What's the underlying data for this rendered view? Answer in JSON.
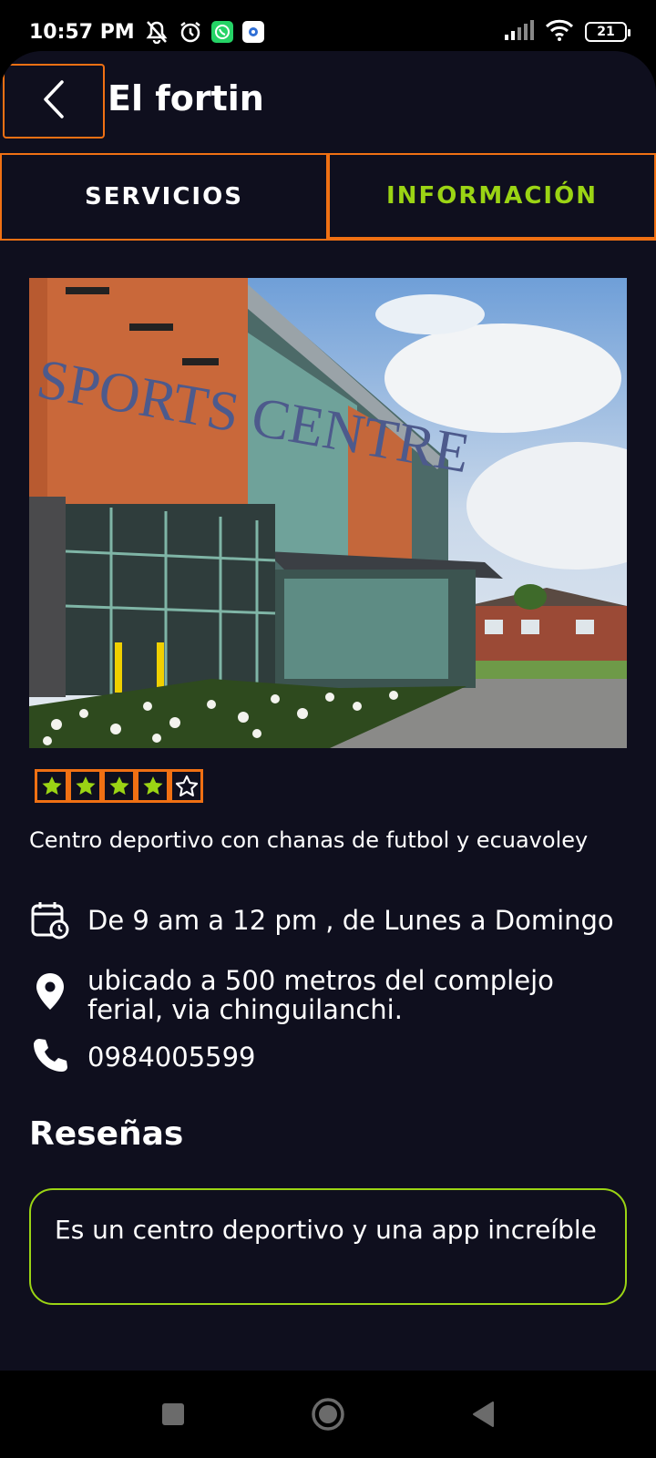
{
  "status_bar": {
    "time": "10:57 PM",
    "battery": "21",
    "icons": [
      "mute-icon",
      "alarm-icon",
      "whatsapp-icon",
      "app-icon",
      "signal-icon",
      "wifi-icon",
      "battery-icon"
    ]
  },
  "header": {
    "title": "El fortin",
    "back_icon": "chevron-left-icon"
  },
  "tabs": [
    {
      "label": "SERVICIOS",
      "active": false
    },
    {
      "label": "INFORMACIÓN",
      "active": true
    }
  ],
  "venue": {
    "image_alt": "sports-centre-photo",
    "sign_text": "SPORTS CENTRE",
    "rating": 4,
    "rating_max": 5,
    "description": "Centro deportivo con chanas de futbol y ecuavoley",
    "schedule": "De 9 am a 12 pm , de Lunes a Domingo",
    "location": "ubicado a 500 metros del complejo ferial, via chinguilanchi.",
    "phone": "0984005599"
  },
  "reviews": {
    "title": "Reseñas",
    "items": [
      {
        "text": "Es un centro deportivo y una app increíble"
      }
    ]
  },
  "colors": {
    "background": "#0f0f1e",
    "accent_green": "#9bd414",
    "highlight_orange": "#f07013"
  },
  "nav": [
    "recents-square-icon",
    "home-circle-icon",
    "back-triangle-icon"
  ]
}
